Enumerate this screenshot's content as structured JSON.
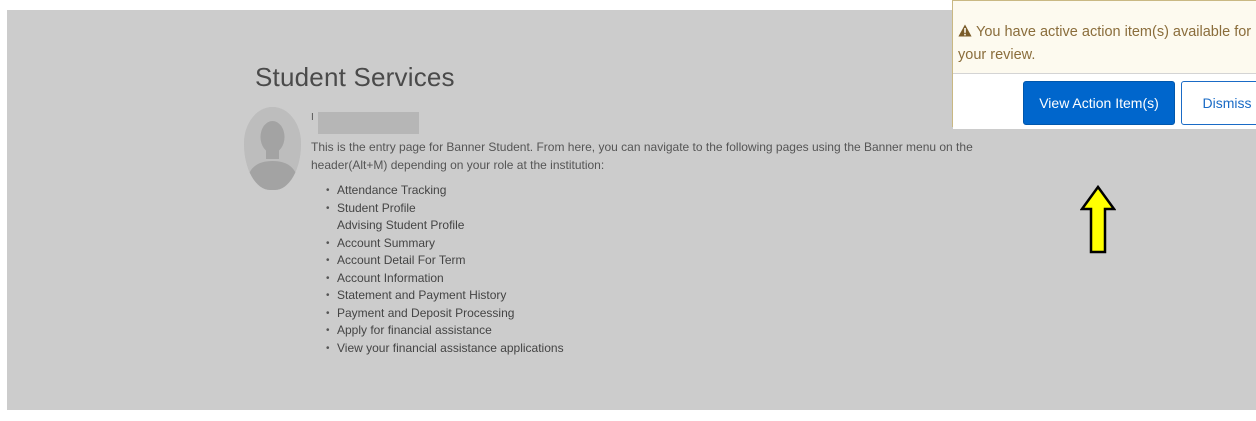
{
  "header": {
    "title": "Student Services"
  },
  "welcome": {
    "greeting_initial": "I",
    "intro": "This is the entry page for Banner Student. From here, you can navigate to the following pages using the Banner menu on the header(Alt+M) depending on your role at the institution:"
  },
  "links": [
    {
      "label": "Attendance Tracking",
      "bullet": true
    },
    {
      "label": "Student Profile",
      "bullet": true
    },
    {
      "label": "Advising Student Profile",
      "bullet": false
    },
    {
      "label": "Account Summary",
      "bullet": true
    },
    {
      "label": "Account Detail For Term",
      "bullet": true
    },
    {
      "label": "Account Information",
      "bullet": true
    },
    {
      "label": "Statement and Payment History",
      "bullet": true
    },
    {
      "label": "Payment and Deposit Processing",
      "bullet": true
    },
    {
      "label": "Apply for financial assistance",
      "bullet": true
    },
    {
      "label": "View your financial assistance applications",
      "bullet": true
    }
  ],
  "notification": {
    "icon": "warning-icon",
    "message": "You have active action item(s) available for your review.",
    "view_label": "View Action Item(s)",
    "dismiss_label": "Dismiss"
  },
  "annotation": {
    "icon": "up-arrow-icon",
    "color": "#ffff00"
  },
  "colors": {
    "primary": "#0066cc",
    "warning_text": "#8a6d3b"
  }
}
